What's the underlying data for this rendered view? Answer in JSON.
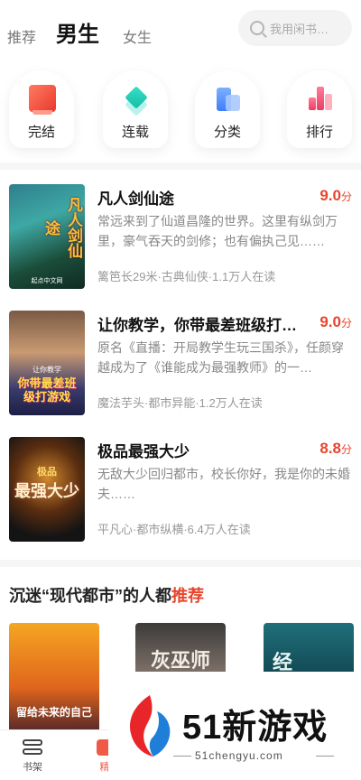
{
  "header": {
    "tabs": [
      {
        "label": "推荐"
      },
      {
        "label": "男生"
      },
      {
        "label": "女生"
      }
    ],
    "search_placeholder": "我用闲书…"
  },
  "categories": [
    {
      "label": "完结",
      "icon": "book-icon"
    },
    {
      "label": "连载",
      "icon": "layers-icon"
    },
    {
      "label": "分类",
      "icon": "folder-icon"
    },
    {
      "label": "排行",
      "icon": "bar-chart-icon"
    }
  ],
  "books": [
    {
      "title": "凡人剑仙途",
      "score": "9.0",
      "score_unit": "分",
      "desc": "常远来到了仙道昌隆的世界。这里有纵剑万里，豪气吞天的剑修；也有偏执己见……",
      "meta": "篱笆长29米·古典仙侠·1.1万人在读",
      "cover_text": "凡人剑仙途",
      "cover_sub": "起点中文网"
    },
    {
      "title": "让你教学，你带最差班级打游…",
      "score": "9.0",
      "score_unit": "分",
      "desc": "原名《直播：开局教学生玩三国杀》，任颜穿越成为了《谁能成为最强教师》的一…",
      "meta": "魔法芋头·都市异能·1.2万人在读",
      "cover_text": "你带最差班级打游戏",
      "cover_sub": "让你教学"
    },
    {
      "title": "极品最强大少",
      "score": "8.8",
      "score_unit": "分",
      "desc": "无敌大少回归都市，校长你好，我是你的未婚夫……",
      "meta": "平凡心·都市纵横·6.4万人在读",
      "cover_text": "最强大少",
      "cover_sub": "极品"
    }
  ],
  "section": {
    "title_prefix": "沉迷“现代都市”的人都",
    "title_highlight": "推荐"
  },
  "recommendations": [
    {
      "cover_text": "留给未来的自己"
    },
    {
      "cover_text": "灰巫师"
    },
    {
      "cover_text": "经"
    }
  ],
  "bottom_nav": [
    {
      "label": "书架"
    },
    {
      "label": "精"
    }
  ],
  "watermark": {
    "brand": "51新游戏",
    "url": "51chengyu.com"
  },
  "colors": {
    "accent": "#e8452c"
  }
}
